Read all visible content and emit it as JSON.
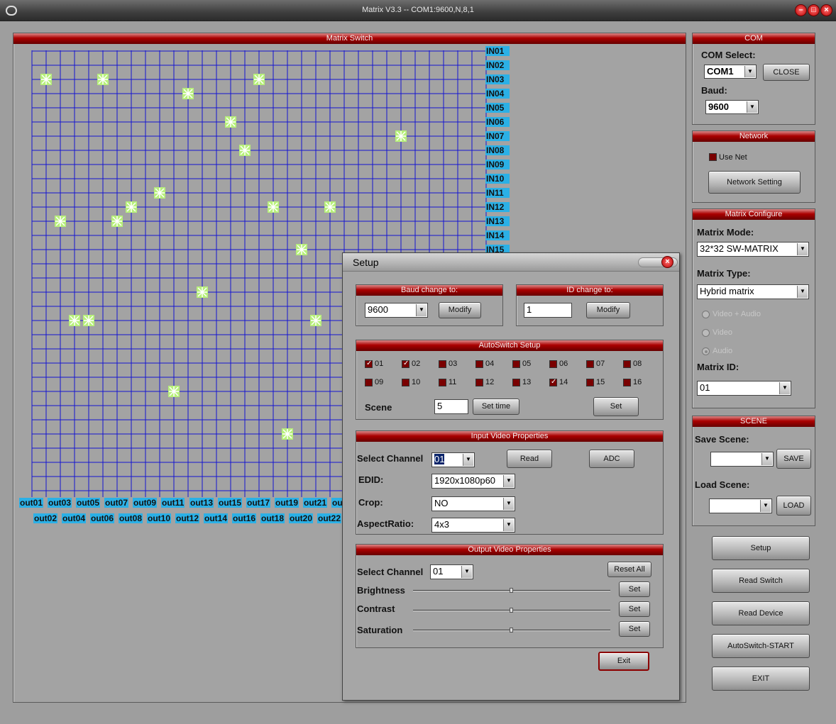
{
  "window": {
    "title": "Matrix V3.3 -- COM1:9600,N,8,1"
  },
  "matrix": {
    "title": "Matrix Switch",
    "inputs": [
      "IN01",
      "IN02",
      "IN03",
      "IN04",
      "IN05",
      "IN06",
      "IN07",
      "IN08",
      "IN09",
      "IN10",
      "IN11",
      "IN12",
      "IN13",
      "IN14",
      "IN15"
    ],
    "outputs_top": [
      "out01",
      "out03",
      "out05",
      "out07",
      "out09",
      "out11",
      "out13",
      "out15",
      "out17",
      "out19",
      "out21",
      "ou"
    ],
    "outputs_bottom": [
      "out02",
      "out04",
      "out06",
      "out08",
      "out10",
      "out12",
      "out14",
      "out16",
      "out18",
      "out20",
      "out22"
    ],
    "connections": [
      [
        1,
        3
      ],
      [
        5,
        3
      ],
      [
        16,
        3
      ],
      [
        11,
        4
      ],
      [
        14,
        6
      ],
      [
        26,
        7
      ],
      [
        15,
        8
      ],
      [
        9,
        11
      ],
      [
        7,
        12
      ],
      [
        17,
        12
      ],
      [
        21,
        12
      ],
      [
        2,
        13
      ],
      [
        6,
        13
      ],
      [
        19,
        15
      ],
      [
        12,
        18
      ],
      [
        3,
        20
      ],
      [
        4,
        20
      ],
      [
        20,
        20
      ],
      [
        10,
        25
      ],
      [
        18,
        28
      ]
    ]
  },
  "com": {
    "title": "COM",
    "select_label": "COM Select:",
    "port": "COM1",
    "close_label": "CLOSE",
    "baud_label": "Baud:",
    "baud": "9600"
  },
  "network": {
    "title": "Network",
    "use_net": "Use Net",
    "setting_label": "Network Setting"
  },
  "config": {
    "title": "Matrix Configure",
    "mode_label": "Matrix Mode:",
    "mode": "32*32 SW-MATRIX",
    "type_label": "Matrix Type:",
    "type": "Hybrid matrix",
    "radio_va": "Video + Audio",
    "radio_v": "Video",
    "radio_a": "Audio",
    "id_label": "Matrix ID:",
    "id": "01"
  },
  "scene": {
    "title": "SCENE",
    "save_label": "Save Scene:",
    "save_btn": "SAVE",
    "load_label": "Load Scene:",
    "load_btn": "LOAD"
  },
  "actions": {
    "setup": "Setup",
    "read_switch": "Read Switch",
    "read_device": "Read Device",
    "autoswitch": "AutoSwitch-START",
    "exit": "EXIT"
  },
  "setup": {
    "title": "Setup",
    "baud_head": "Baud change to:",
    "baud_value": "9600",
    "id_head": "ID change to:",
    "id_value": "1",
    "modify": "Modify",
    "auto_head": "AutoSwitch Setup",
    "channels": [
      {
        "n": "01",
        "on": true
      },
      {
        "n": "02",
        "on": true
      },
      {
        "n": "03",
        "on": false
      },
      {
        "n": "04",
        "on": false
      },
      {
        "n": "05",
        "on": false
      },
      {
        "n": "06",
        "on": false
      },
      {
        "n": "07",
        "on": false
      },
      {
        "n": "08",
        "on": false
      },
      {
        "n": "09",
        "on": false
      },
      {
        "n": "10",
        "on": false
      },
      {
        "n": "11",
        "on": false
      },
      {
        "n": "12",
        "on": false
      },
      {
        "n": "13",
        "on": false
      },
      {
        "n": "14",
        "on": true
      },
      {
        "n": "15",
        "on": false
      },
      {
        "n": "16",
        "on": false
      }
    ],
    "scene_label": "Scene",
    "scene_value": "5",
    "set_time": "Set time",
    "set": "Set",
    "input_head": "Input Video Properties",
    "select_channel": "Select Channel",
    "in_channel": "01",
    "read": "Read",
    "adc": "ADC",
    "edid_label": "EDID:",
    "edid": "1920x1080p60",
    "crop_label": "Crop:",
    "crop": "NO",
    "aspect_label": "AspectRatio:",
    "aspect": "4x3",
    "output_head": "Output Video Properties",
    "out_channel": "01",
    "reset_all": "Reset All",
    "brightness": "Brightness",
    "contrast": "Contrast",
    "saturation": "Saturation",
    "exit": "Exit"
  }
}
